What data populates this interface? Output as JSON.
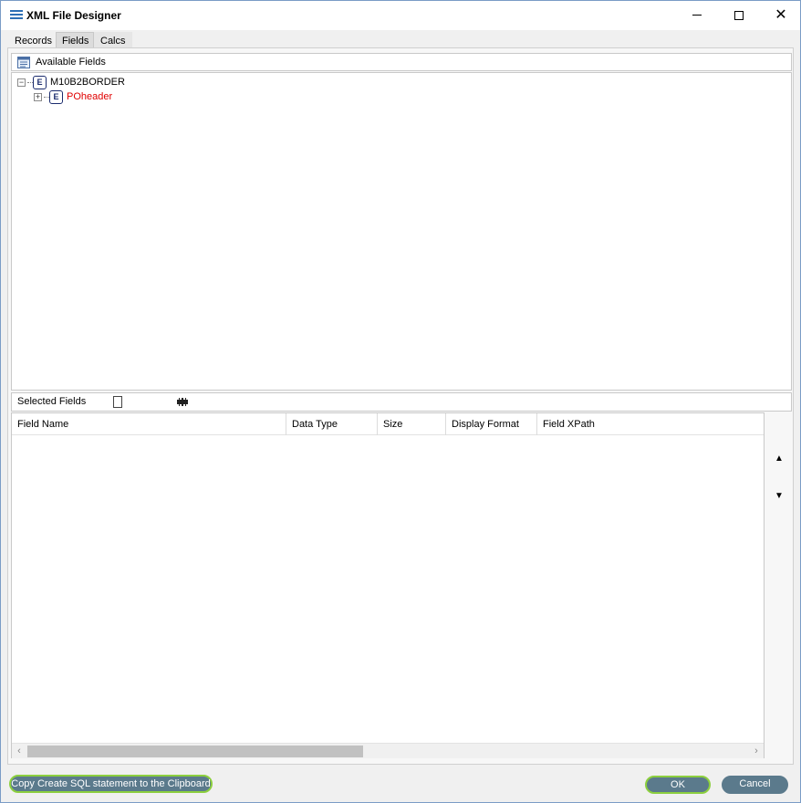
{
  "window": {
    "title": "XML File Designer",
    "controls": {
      "minimize": "minimize",
      "maximize": "maximize",
      "close": "✕"
    }
  },
  "tabs": [
    {
      "label": "Records",
      "active": false
    },
    {
      "label": "Fields",
      "active": true
    },
    {
      "label": "Calcs",
      "active": false
    }
  ],
  "available_fields": {
    "header": "Available Fields",
    "tree": [
      {
        "label": "M10B2BORDER",
        "expander": "−",
        "icon": "element-icon",
        "icon_text": "E",
        "color": "#000000"
      },
      {
        "label": "POheader",
        "expander": "+",
        "icon": "element-icon",
        "icon_text": "E",
        "color": "#e00000"
      }
    ]
  },
  "selected_fields": {
    "header": "Selected Fields",
    "icons": [
      "new-document-icon",
      "filmstrip-icon"
    ],
    "columns": [
      "Field Name",
      "Data Type",
      "Size",
      "Display Format",
      "Field XPath"
    ],
    "rows": [],
    "scroll_left": "‹",
    "scroll_right": "›",
    "move_up": "▲",
    "move_down": "▼"
  },
  "buttons": {
    "copy_sql": "Copy Create SQL statement to the Clipboard",
    "ok": "OK",
    "cancel": "Cancel"
  },
  "colors": {
    "button_fill": "#5b7a8c",
    "focus_border": "#8ccf3e",
    "highlight_node": "#e00000"
  }
}
